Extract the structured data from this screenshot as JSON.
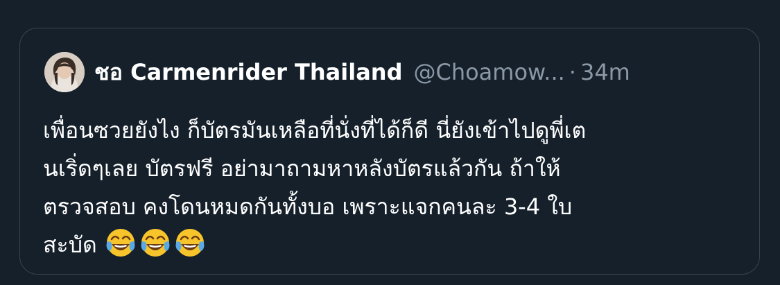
{
  "tweet": {
    "author_name": "ชอ Carmenrider Thailand",
    "handle": "@Choamow...",
    "separator": "·",
    "time": "34m",
    "text_lines": [
      "เพื่อนซวยยังไง ก็บัตรมันเหลือที่นั่งที่ได้ก็ดี นี่ยังเข้าไปดูพี่เต",
      "นเริ่ดๆเลย บัตรฟรี อย่ามาถามหาหลังบัตรแล้วกัน ถ้าให้",
      "ตรวจสอบ คงโดนหมดกันทั้งบอ เพราะแจกคนละ 3-4 ใบ",
      "สะบัด"
    ],
    "emojis": [
      "face-with-tears-of-joy-icon",
      "face-with-tears-of-joy-icon",
      "face-with-tears-of-joy-icon"
    ]
  },
  "colors": {
    "background": "#15202b",
    "border": "#38444d",
    "primary_text": "#ffffff",
    "secondary_text": "#8b98a5"
  }
}
